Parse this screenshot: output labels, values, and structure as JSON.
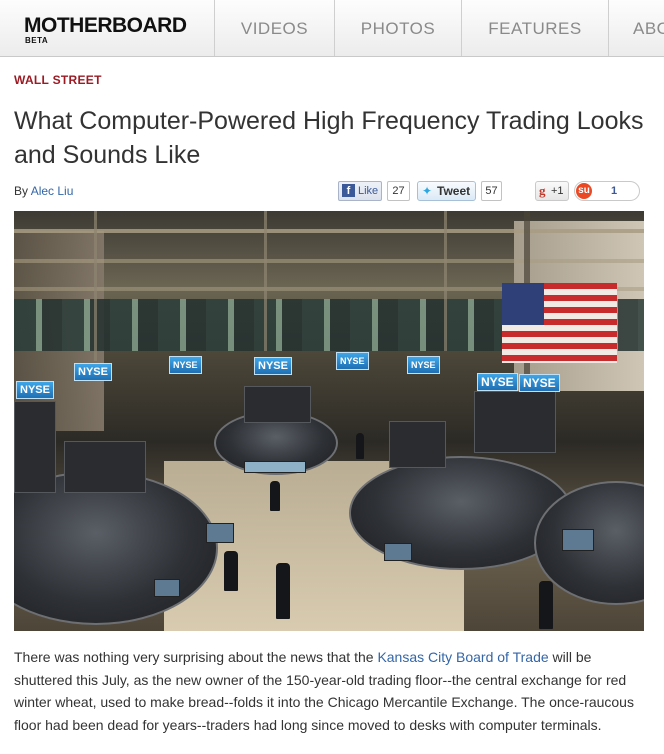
{
  "nav": {
    "logo": "MOTHERBOARD",
    "logo_sub": "BETA",
    "items": [
      "VIDEOS",
      "PHOTOS",
      "FEATURES",
      "ABOUT"
    ]
  },
  "article": {
    "section": "WALL STREET",
    "title": "What Computer-Powered High Frequency Trading Looks and Sounds Like",
    "byline_prefix": "By",
    "author": "Alec Liu",
    "hero_signs": [
      "NYSE",
      "NYSE",
      "NYSE",
      "NYSE",
      "NYSE",
      "NYSE",
      "NYSE",
      "NYSE"
    ],
    "body": {
      "part1": "There was nothing very surprising about the news that the ",
      "link": "Kansas City Board of Trade",
      "part2": " will be shuttered this July, as the new owner of the 150-year-old trading floor--the central exchange for red winter wheat, used to make bread--folds it into the Chicago Mercantile Exchange. The once-raucous floor had been dead for years--traders had long since moved to desks with computer terminals."
    }
  },
  "share": {
    "facebook": {
      "label": "Like",
      "count": "27",
      "icon": "facebook-icon"
    },
    "twitter": {
      "label": "Tweet",
      "count": "57",
      "icon": "twitter-bird-icon"
    },
    "googleplus": {
      "label": "+1",
      "icon": "google-plus-icon"
    },
    "stumbleupon": {
      "count": "1",
      "icon": "stumbleupon-icon"
    }
  },
  "colors": {
    "section_red": "#9b1b24",
    "link_blue": "#3366a8",
    "nav_text": "#8a8a8a"
  }
}
